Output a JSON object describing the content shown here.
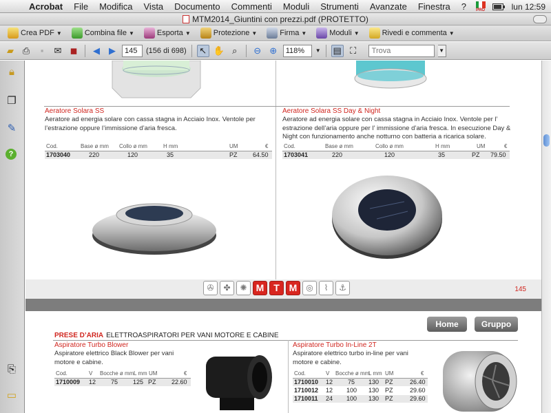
{
  "menubar": {
    "app": "Acrobat",
    "items": [
      "File",
      "Modifica",
      "Vista",
      "Documento",
      "Commenti",
      "Moduli",
      "Strumenti",
      "Avanzate",
      "Finestra",
      "?"
    ],
    "flag_label": "PRO",
    "clock": "lun 12:59"
  },
  "window": {
    "title": "MTM2014_Giuntini con prezzi.pdf (PROTETTO)"
  },
  "toolbar1": {
    "buttons": [
      "Crea PDF",
      "Combina file",
      "Esporta",
      "Protezione",
      "Firma",
      "Moduli",
      "Rivedi e commenta"
    ]
  },
  "toolbar2": {
    "page_value": "145",
    "page_count": "(156 di 698)",
    "zoom": "118%",
    "search_placeholder": "Trova"
  },
  "page1": {
    "left": {
      "title": "Aeratore Solara SS",
      "desc": "Aeratore ad energia solare con cassa stagna in Acciaio Inox. Ventole per l’estrazione oppure l’immissione d’aria fresca.",
      "headers": [
        "Cod.",
        "Base ø mm",
        "Collo ø mm",
        "H mm",
        "UM",
        "€"
      ],
      "row": [
        "1703040",
        "220",
        "120",
        "35",
        "PZ",
        "64.50"
      ]
    },
    "right": {
      "title": "Aeratore Solara SS Day & Night",
      "desc": "Aeratore ad energia solare con cassa stagna in Acciaio Inox. Ventole per l’ estrazione dell’aria oppure per l’ immissione d’aria fresca. In esecuzione Day & Night con funzionamento anche notturno con batteria a ricarica solare.",
      "headers": [
        "Cod.",
        "Base ø mm",
        "Collo ø mm",
        "H mm",
        "UM",
        "€"
      ],
      "row": [
        "1703041",
        "220",
        "120",
        "35",
        "PZ",
        "79.50"
      ]
    },
    "category_letters": [
      "M",
      "T",
      "M"
    ],
    "page_number": "145"
  },
  "page2": {
    "section_red": "PRESE D’ARIA",
    "section_rest": "ELETTROASPIRATORI PER VANI MOTORE E CABINE",
    "home": "Home",
    "gruppo": "Gruppo",
    "left": {
      "title": "Aspiratore Turbo Blower",
      "desc": "Aspiratore elettrico Black Blower per vani motore e cabine.",
      "headers": [
        "Cod.",
        "V",
        "Bocche ø mm",
        "L mm",
        "UM",
        "€"
      ],
      "rows": [
        [
          "1710009",
          "12",
          "75",
          "125",
          "PZ",
          "22.60"
        ]
      ]
    },
    "right": {
      "title": "Aspiratore Turbo In-Line 2T",
      "desc": "Aspiratore elettrico turbo in-line per vani motore e cabine.",
      "headers": [
        "Cod.",
        "V",
        "Bocche ø mm",
        "L mm",
        "UM",
        "€"
      ],
      "rows": [
        [
          "1710010",
          "12",
          "75",
          "130",
          "PZ",
          "26.40"
        ],
        [
          "1710012",
          "12",
          "100",
          "130",
          "PZ",
          "29.60"
        ],
        [
          "1710011",
          "24",
          "100",
          "130",
          "PZ",
          "29.60"
        ]
      ]
    }
  }
}
